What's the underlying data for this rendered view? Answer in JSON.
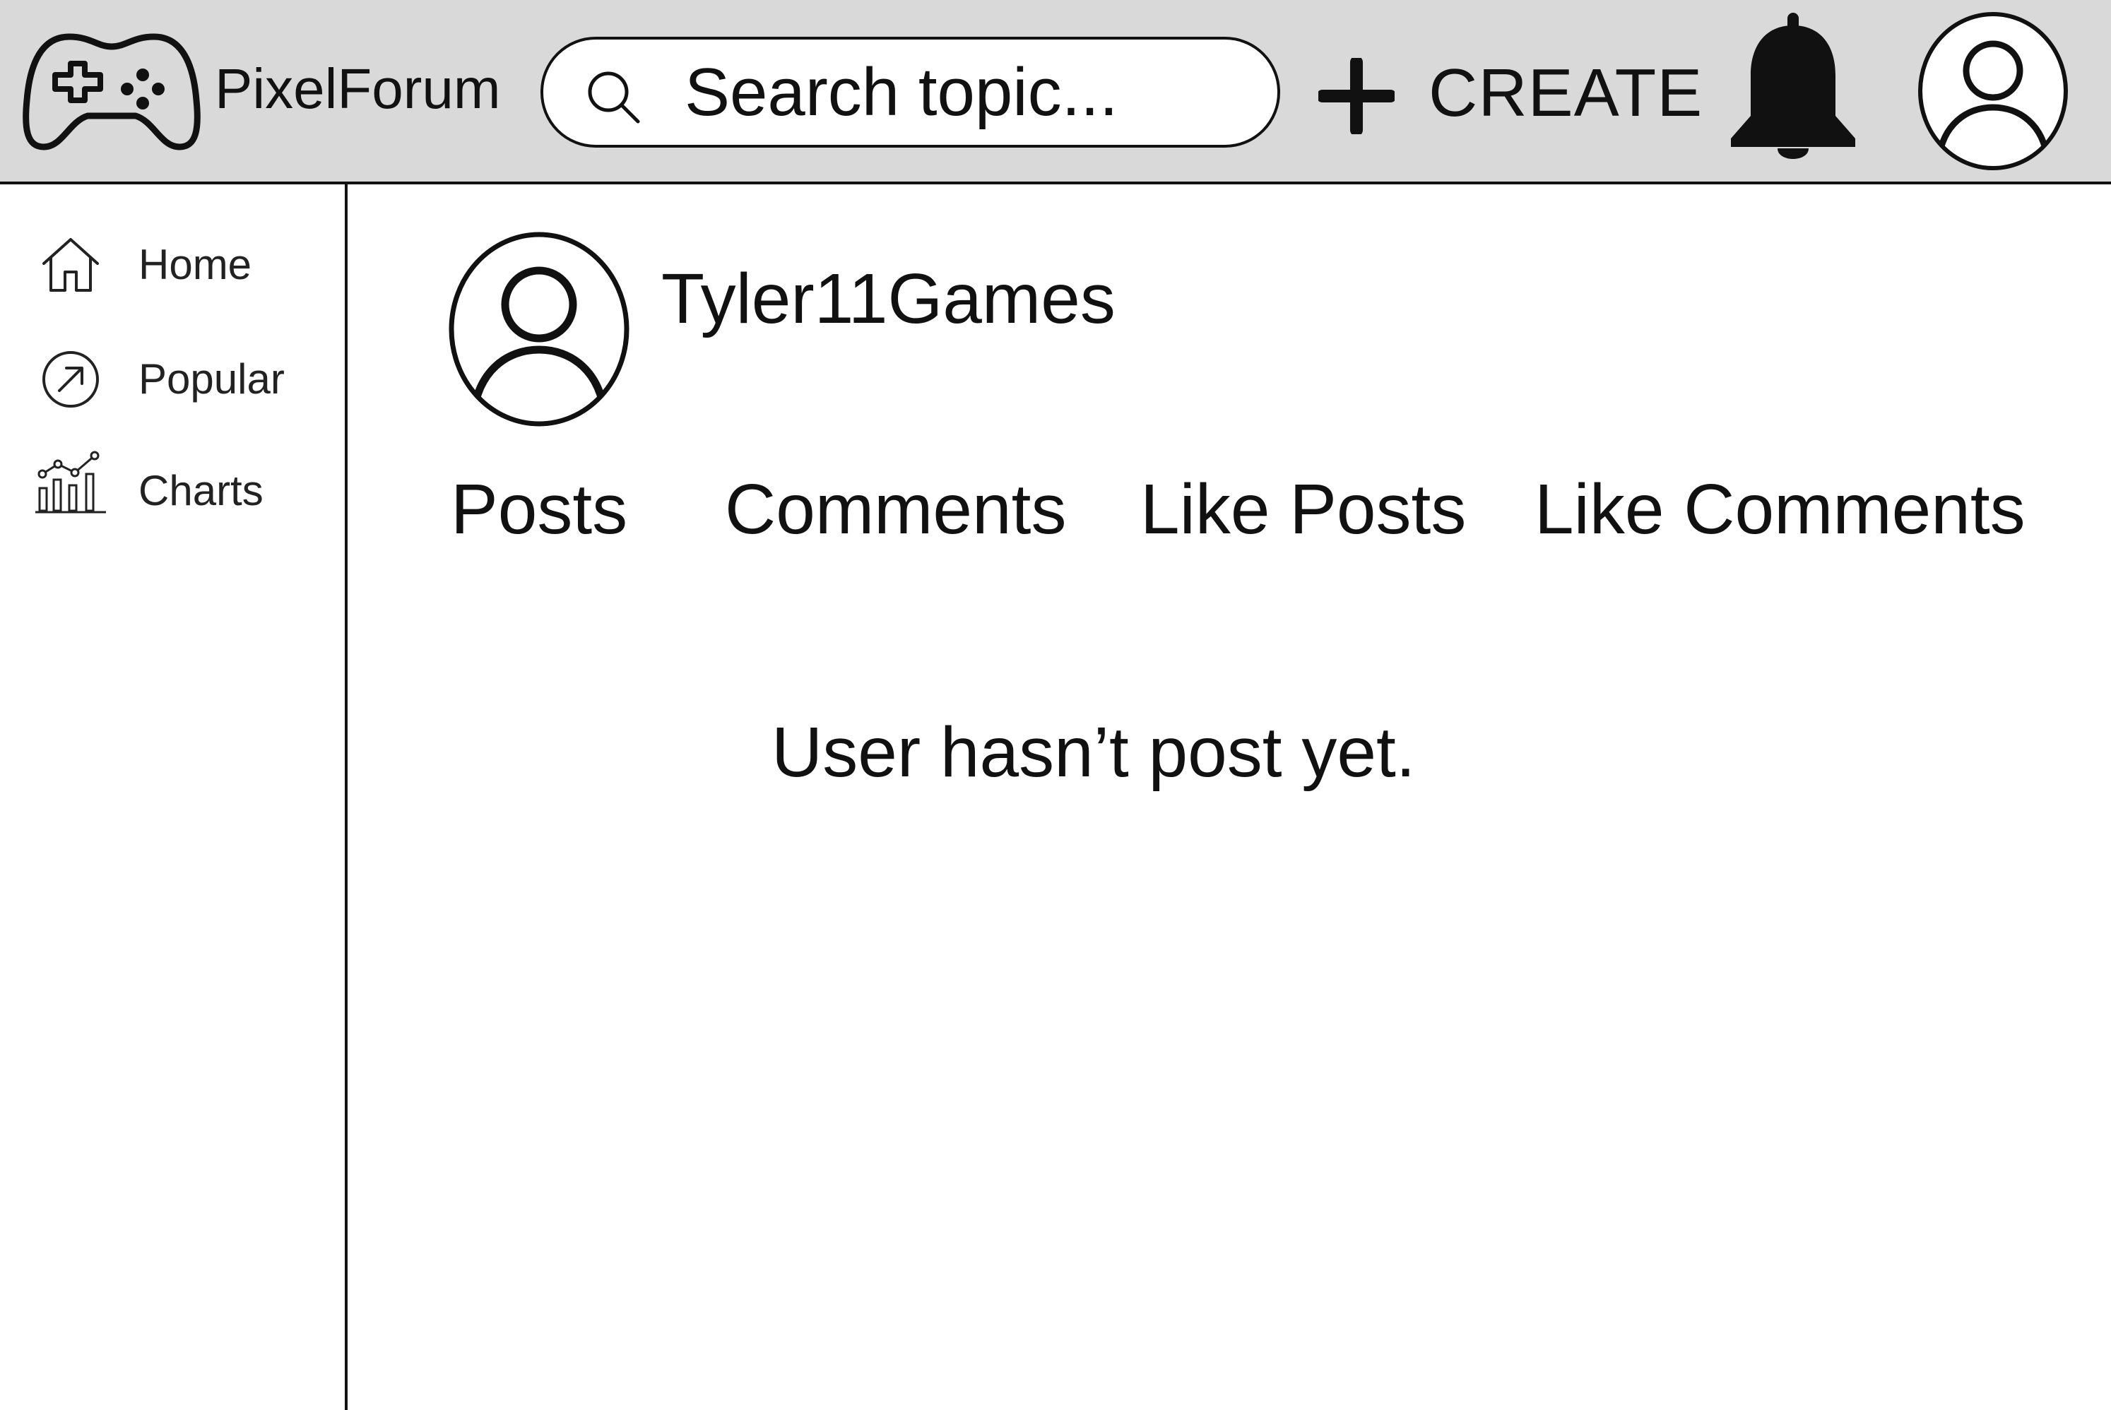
{
  "header": {
    "logo_icon": "gamepad-icon",
    "brand": "PixelForum",
    "search": {
      "icon": "search-icon",
      "placeholder": "Search topic...",
      "value": ""
    },
    "create": {
      "icon": "plus-icon",
      "label": "CREATE"
    },
    "notifications_icon": "bell-icon",
    "profile_icon": "user-avatar-icon"
  },
  "sidebar": {
    "items": [
      {
        "icon": "home-icon",
        "label": "Home"
      },
      {
        "icon": "trending-arrow-icon",
        "label": "Popular"
      },
      {
        "icon": "bar-chart-icon",
        "label": "Charts"
      }
    ]
  },
  "profile": {
    "avatar_icon": "user-avatar-icon",
    "username": "Tyler11Games",
    "tabs": [
      {
        "label": "Posts"
      },
      {
        "label": "Comments"
      },
      {
        "label": "Like Posts"
      },
      {
        "label": "Like Comments"
      }
    ],
    "empty_message": "User hasn’t post yet."
  },
  "colors": {
    "header_bg": "#d9d9d9",
    "border": "#111111",
    "background": "#ffffff",
    "text": "#111111"
  }
}
